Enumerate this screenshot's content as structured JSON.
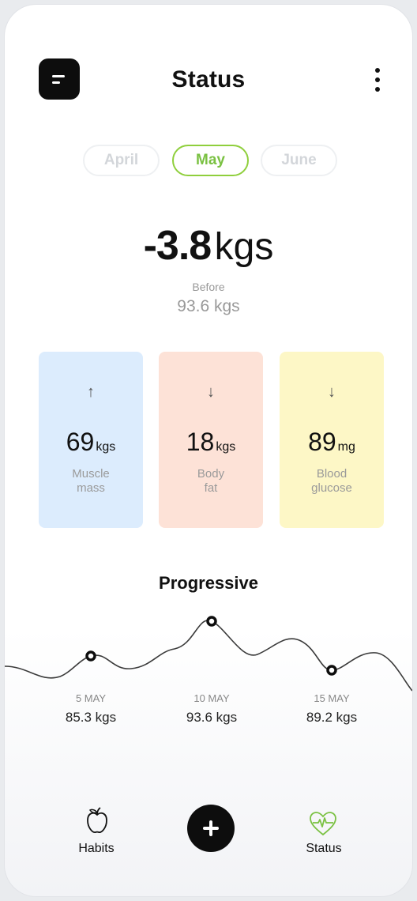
{
  "header": {
    "title": "Status"
  },
  "months": [
    {
      "label": "April",
      "active": false
    },
    {
      "label": "May",
      "active": true
    },
    {
      "label": "June",
      "active": false
    }
  ],
  "summary": {
    "change": "-3.8",
    "unit": "kgs",
    "before_label": "Before",
    "before_value": "93.6 kgs"
  },
  "metrics": [
    {
      "value": "69",
      "unit": "kgs",
      "label_line1": "Muscle",
      "label_line2": "mass",
      "direction": "up",
      "arrow": "↑",
      "color": "#dcecfd"
    },
    {
      "value": "18",
      "unit": "kgs",
      "label_line1": "Body",
      "label_line2": "fat",
      "direction": "down",
      "arrow": "↓",
      "color": "#fde2d7"
    },
    {
      "value": "89",
      "unit": "mg",
      "label_line1": "Blood",
      "label_line2": "glucose",
      "direction": "down",
      "arrow": "↓",
      "color": "#fdf7c6"
    }
  ],
  "progress": {
    "title": "Progressive",
    "points": [
      {
        "date": "5 MAY",
        "value": "85.3 kgs"
      },
      {
        "date": "10 MAY",
        "value": "93.6 kgs"
      },
      {
        "date": "15 MAY",
        "value": "89.2 kgs"
      }
    ]
  },
  "nav": {
    "habits_label": "Habits",
    "status_label": "Status",
    "active_color": "#7ac142"
  }
}
